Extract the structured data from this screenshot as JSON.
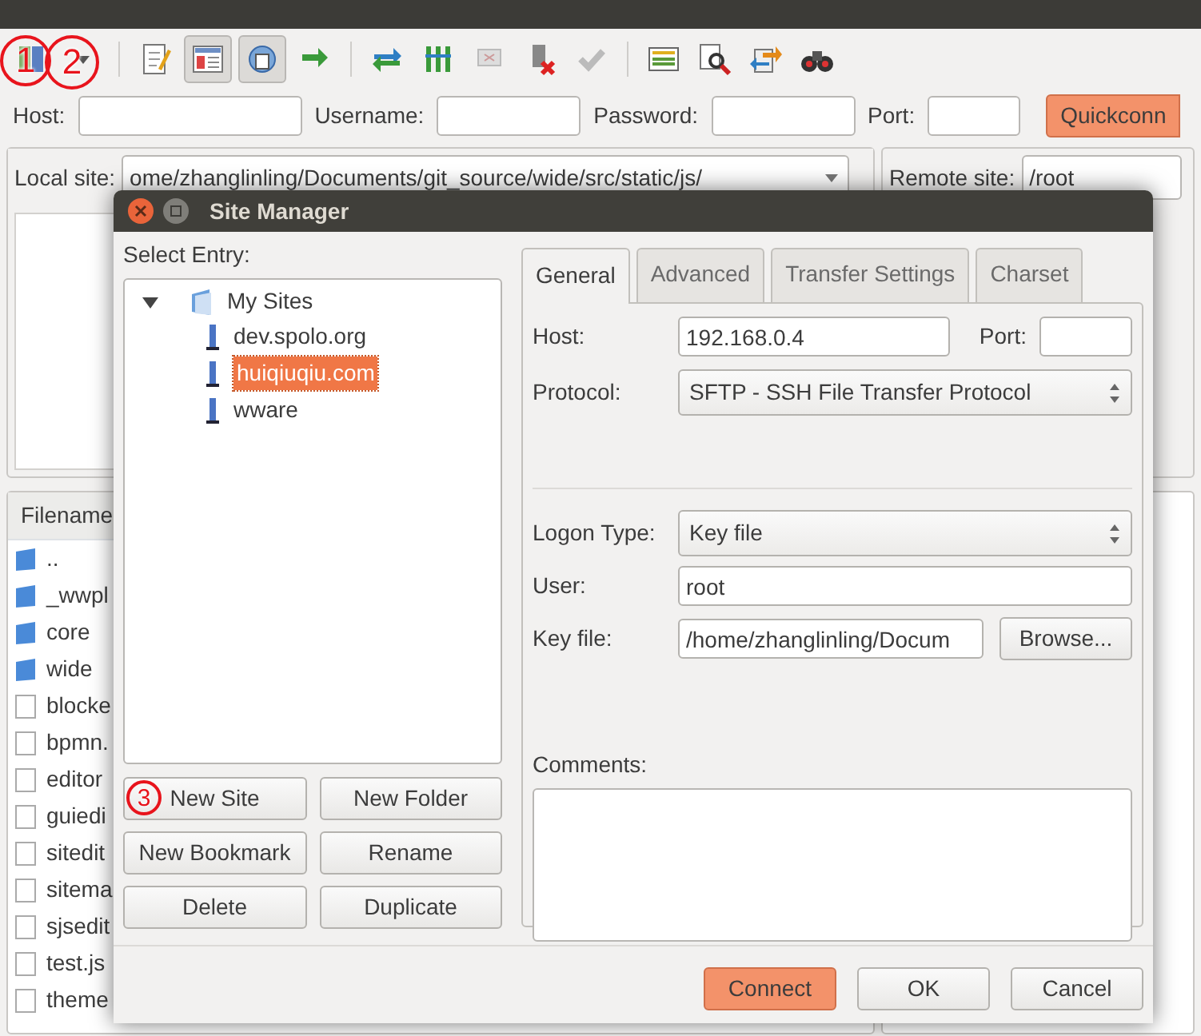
{
  "quickconnect": {
    "fields": [
      {
        "label": "Host:"
      },
      {
        "label": "Username:"
      },
      {
        "label": "Password:"
      },
      {
        "label": "Port:"
      }
    ],
    "button": "Quickconn"
  },
  "local_site": {
    "label": "Local site:",
    "path": "ome/zhanglinling/Documents/git_source/wide/src/static/js/"
  },
  "remote_site": {
    "label": "Remote site:",
    "path": "/root"
  },
  "local_files": {
    "column": "Filename",
    "items": [
      {
        "name": "..",
        "kind": "folder"
      },
      {
        "name": "_wwpl",
        "kind": "folder"
      },
      {
        "name": "core",
        "kind": "folder"
      },
      {
        "name": "wide",
        "kind": "folder"
      },
      {
        "name": "blocke",
        "kind": "file"
      },
      {
        "name": "bpmn.",
        "kind": "file"
      },
      {
        "name": "editor",
        "kind": "file"
      },
      {
        "name": "guiedi",
        "kind": "file"
      },
      {
        "name": "sitedit",
        "kind": "file"
      },
      {
        "name": "sitema",
        "kind": "file"
      },
      {
        "name": "sjsedit",
        "kind": "file"
      },
      {
        "name": "test.js",
        "kind": "file"
      },
      {
        "name": "theme",
        "kind": "file"
      }
    ]
  },
  "dialog": {
    "title": "Site Manager",
    "select_label": "Select Entry:",
    "tree": {
      "label": "My Sites",
      "expanded": true,
      "children": [
        {
          "label": "dev.spolo.org",
          "selected": false
        },
        {
          "label": "huiqiuqiu.com",
          "selected": true
        },
        {
          "label": "wware",
          "selected": false
        }
      ]
    },
    "tree_buttons": [
      "New Site",
      "New Folder",
      "New Bookmark",
      "Rename",
      "Delete",
      "Duplicate"
    ],
    "tabs": [
      {
        "label": "General",
        "selected": true
      },
      {
        "label": "Advanced",
        "selected": false
      },
      {
        "label": "Transfer Settings",
        "selected": false
      },
      {
        "label": "Charset",
        "selected": false
      }
    ],
    "general": {
      "host_label": "Host:",
      "host": "192.168.0.4",
      "port_label": "Port:",
      "protocol_label": "Protocol:",
      "protocol": "SFTP - SSH File Transfer Protocol",
      "logon_label": "Logon Type:",
      "logon": "Key file",
      "user_label": "User:",
      "user": "root",
      "keyfile_label": "Key file:",
      "keyfile": "/home/zhanglinling/Docum",
      "browse": "Browse...",
      "comments_label": "Comments:"
    },
    "buttons": [
      {
        "label": "Connect",
        "kind": "default"
      },
      {
        "label": "OK",
        "kind": "normal"
      },
      {
        "label": "Cancel",
        "kind": "normal"
      }
    ]
  },
  "annotations": [
    {
      "label": "1"
    },
    {
      "label": "2"
    },
    {
      "label": "3"
    }
  ]
}
